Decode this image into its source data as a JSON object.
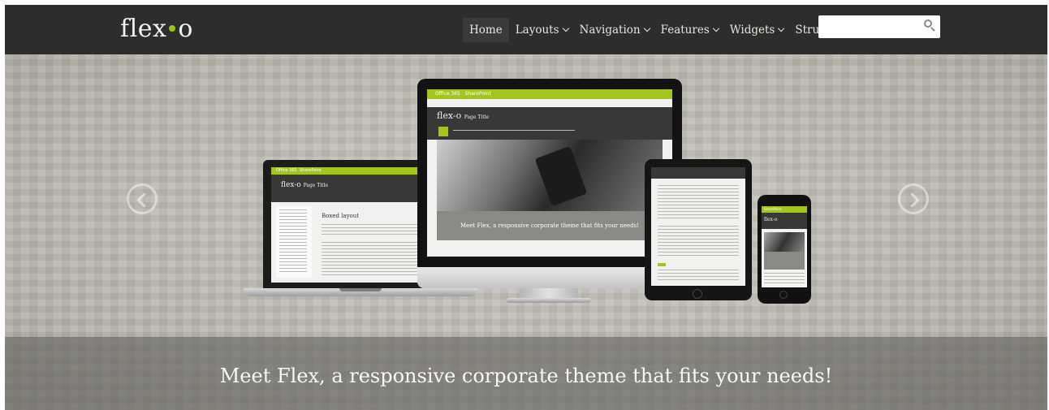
{
  "brand": {
    "logo_left": "flex",
    "logo_right": "o",
    "accent": "#9bc31a"
  },
  "nav": {
    "items": [
      {
        "label": "Home",
        "has_dropdown": false
      },
      {
        "label": "Layouts",
        "has_dropdown": true
      },
      {
        "label": "Navigation",
        "has_dropdown": true
      },
      {
        "label": "Features",
        "has_dropdown": true
      },
      {
        "label": "Widgets",
        "has_dropdown": true
      },
      {
        "label": "Structure",
        "has_dropdown": true
      }
    ]
  },
  "search": {
    "value": "",
    "placeholder": "",
    "icon": "search-icon"
  },
  "hero": {
    "caption": "Meet Flex, a responsive corporate theme that fits your needs!",
    "prev_icon": "chevron-left-icon",
    "next_icon": "chevron-right-icon",
    "mockup": {
      "suite_label": "Office 365",
      "app_label": "SharePoint",
      "site_logo": "flex-o",
      "page_title": "Page Title",
      "content_heading": "Boxed layout",
      "screen_caption": "Meet Flex, a responsive corporate theme that fits your needs!"
    }
  },
  "colors": {
    "topbar": "#2d2d2b",
    "hero_bg": "#bcb9b1",
    "caption_band": "#62615c",
    "o365_bar": "#a3c61e"
  }
}
